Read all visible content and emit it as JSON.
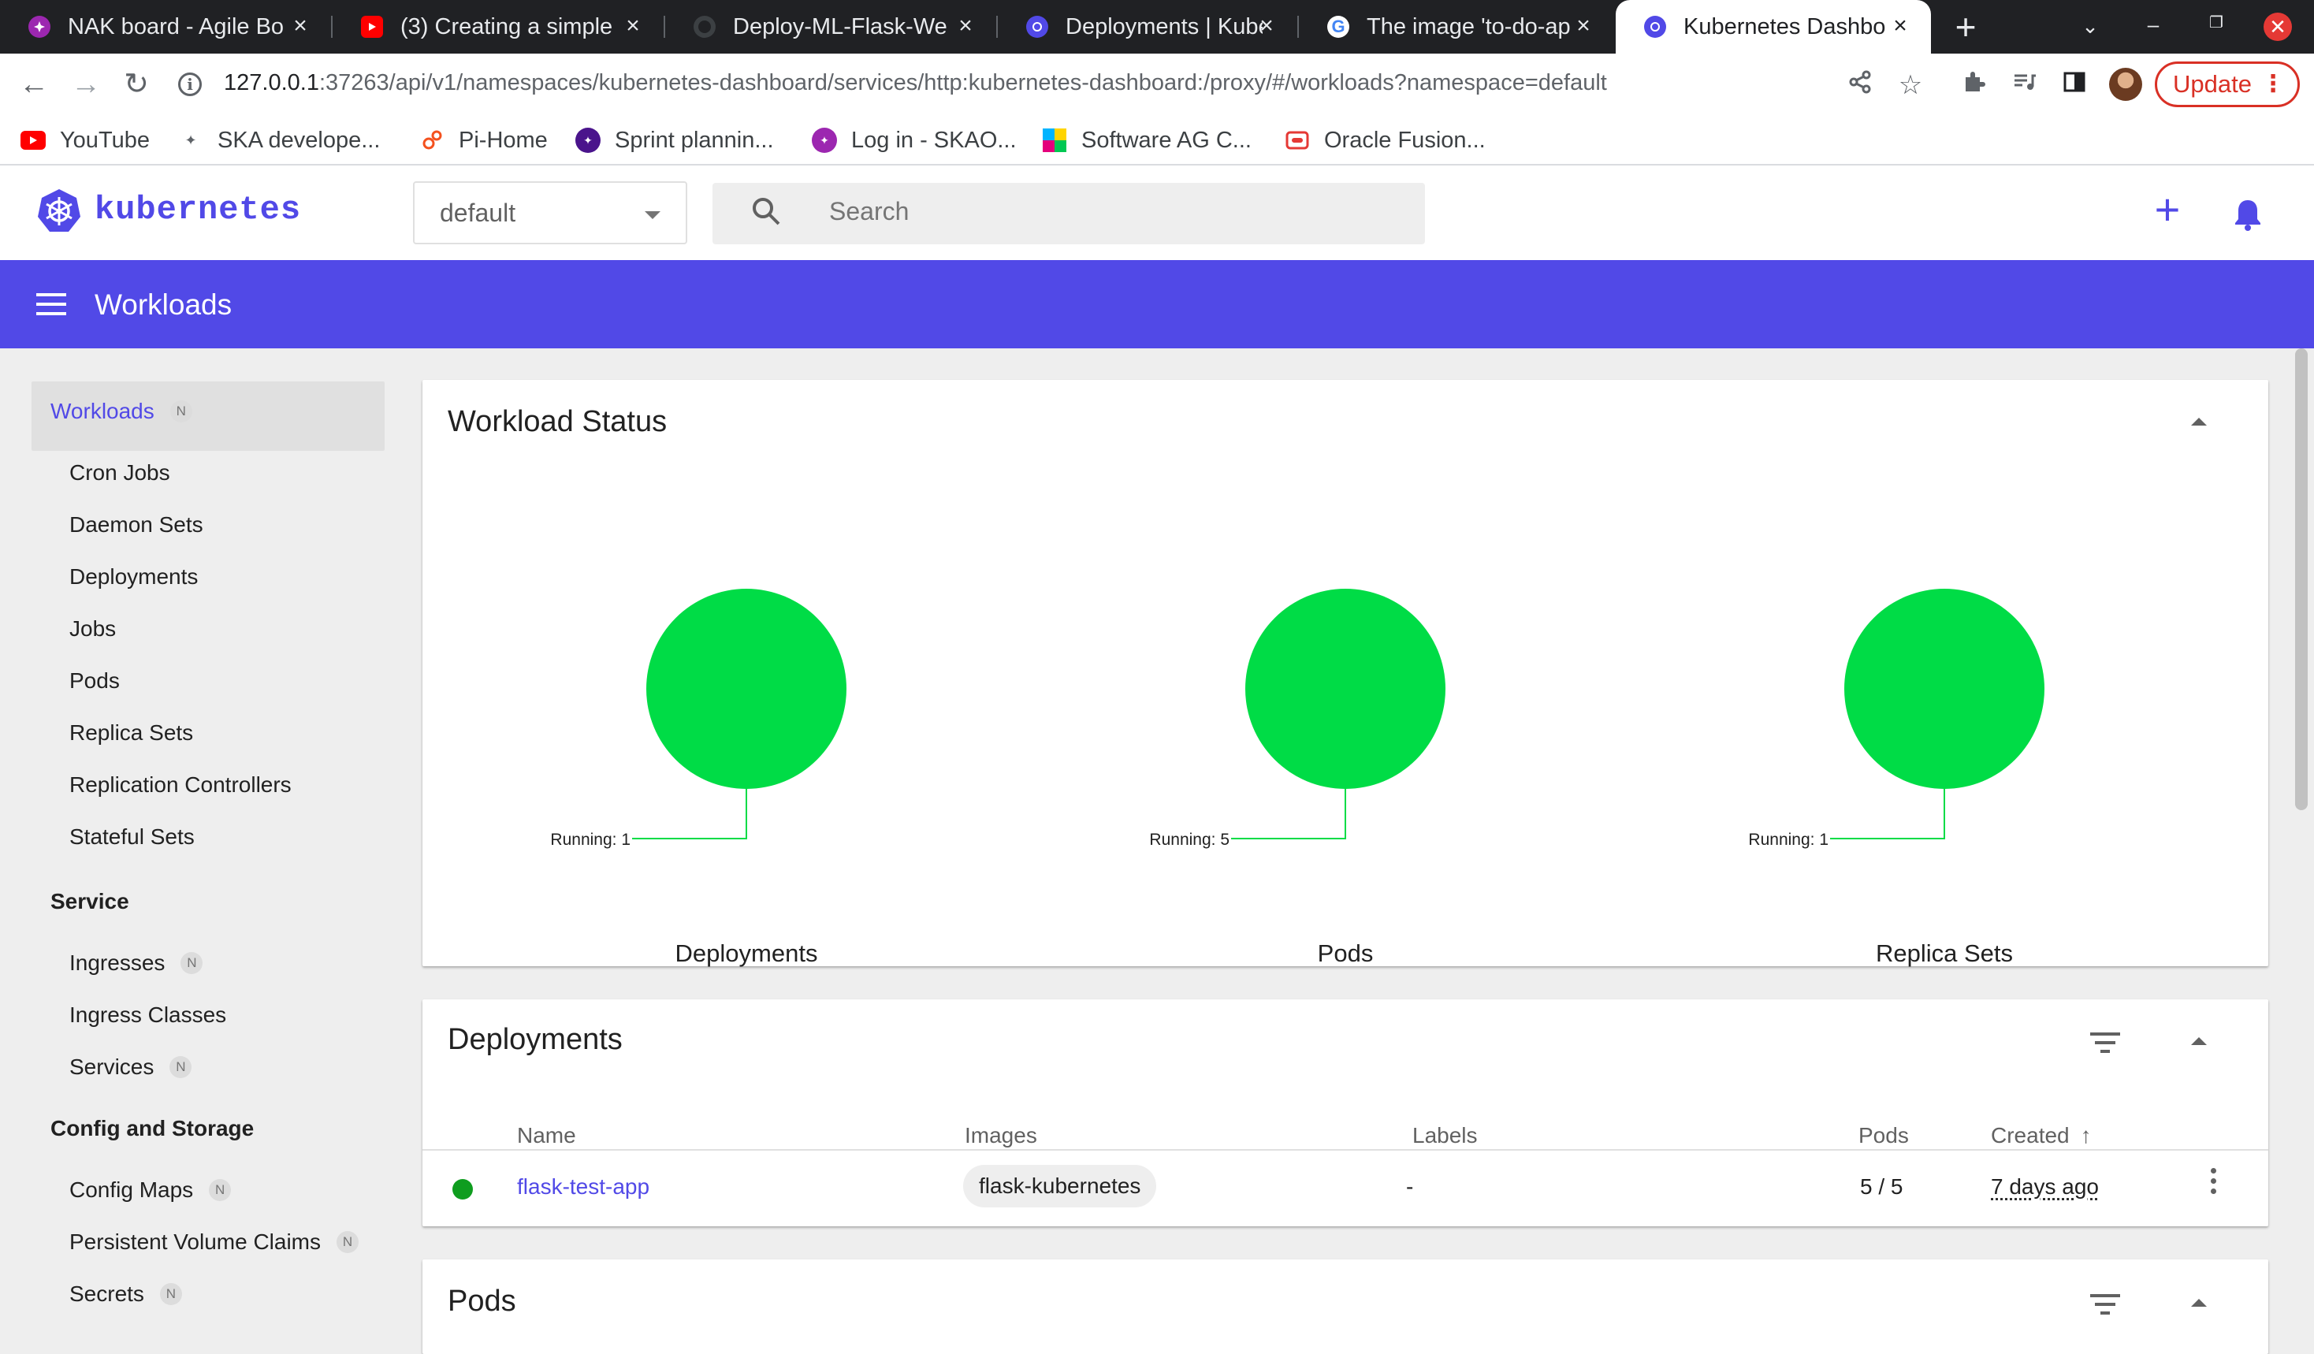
{
  "browser": {
    "tabs": [
      {
        "title": "NAK board - Agile Bo",
        "favicon": "agile-icon",
        "color": "#9c27b0"
      },
      {
        "title": "(3) Creating a simple",
        "favicon": "youtube-icon",
        "color": "#ff0000"
      },
      {
        "title": "Deploy-ML-Flask-We",
        "favicon": "github-icon",
        "color": "#202124"
      },
      {
        "title": "Deployments | Kube",
        "favicon": "kubernetes-icon",
        "color": "#326ce5"
      },
      {
        "title": "The image 'to-do-ap",
        "favicon": "google-icon",
        "color": "#4285f4"
      },
      {
        "title": "Kubernetes Dashbo",
        "favicon": "kubernetes-icon",
        "color": "#326ce5"
      }
    ],
    "url_host": "127.0.0.1",
    "url_rest": ":37263/api/v1/namespaces/kubernetes-dashboard/services/http:kubernetes-dashboard:/proxy/#/workloads?namespace=default",
    "update_label": "Update",
    "bookmarks": [
      {
        "label": "YouTube",
        "icon": "youtube-icon"
      },
      {
        "label": "SKA develope...",
        "icon": "ska-icon"
      },
      {
        "label": "Pi-Home",
        "icon": "pi-icon"
      },
      {
        "label": "Sprint plannin...",
        "icon": "agile-icon"
      },
      {
        "label": "Log in - SKAO...",
        "icon": "skao-icon"
      },
      {
        "label": "Software AG C...",
        "icon": "softwareag-icon"
      },
      {
        "label": "Oracle Fusion...",
        "icon": "oracle-icon"
      }
    ]
  },
  "header": {
    "brand": "kubernetes",
    "namespace": "default",
    "search_placeholder": "Search"
  },
  "toolbar": {
    "title": "Workloads"
  },
  "sidebar": {
    "workloads": {
      "label": "Workloads",
      "badge": "N"
    },
    "workload_items": [
      "Cron Jobs",
      "Daemon Sets",
      "Deployments",
      "Jobs",
      "Pods",
      "Replica Sets",
      "Replication Controllers",
      "Stateful Sets"
    ],
    "service": {
      "label": "Service",
      "items": [
        {
          "label": "Ingresses",
          "badge": "N"
        },
        {
          "label": "Ingress Classes",
          "badge": ""
        },
        {
          "label": "Services",
          "badge": "N"
        }
      ]
    },
    "config": {
      "label": "Config and Storage",
      "items": [
        {
          "label": "Config Maps",
          "badge": "N"
        },
        {
          "label": "Persistent Volume Claims",
          "badge": "N"
        },
        {
          "label": "Secrets",
          "badge": "N"
        }
      ]
    }
  },
  "workload_status": {
    "title": "Workload Status",
    "running_color": "#00dc46",
    "items": [
      {
        "name": "Deployments",
        "running_label": "Running: 1"
      },
      {
        "name": "Pods",
        "running_label": "Running: 5"
      },
      {
        "name": "Replica Sets",
        "running_label": "Running: 1"
      }
    ]
  },
  "deployments": {
    "title": "Deployments",
    "columns": {
      "name": "Name",
      "images": "Images",
      "labels": "Labels",
      "pods": "Pods",
      "created": "Created"
    },
    "rows": [
      {
        "name": "flask-test-app",
        "image": "flask-kubernetes",
        "labels": "-",
        "pods": "5 / 5",
        "created": "7 days ago"
      }
    ]
  },
  "pods_card": {
    "title": "Pods"
  }
}
